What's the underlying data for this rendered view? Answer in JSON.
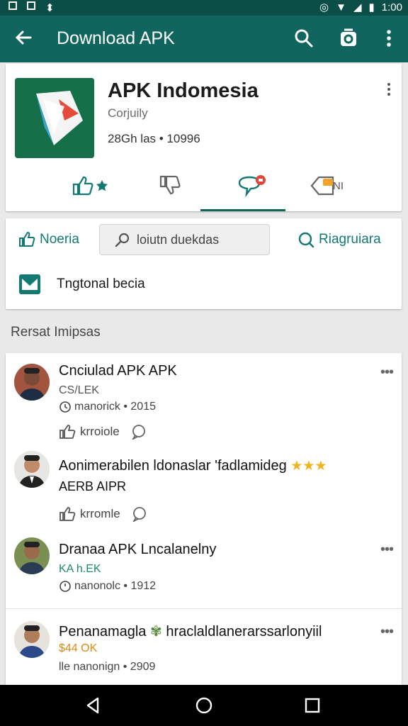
{
  "status_bar": {
    "time": "1:00"
  },
  "app_bar": {
    "title": "Download APK"
  },
  "app": {
    "name": "APK Indomesia",
    "developer": "Corjuily",
    "stats": "28Gh las • 10996",
    "tab_labels": [
      "",
      "",
      "",
      "NI"
    ]
  },
  "actions": {
    "left_link": "Noeria",
    "search_text": "loiutn duekdas",
    "right_link": "Riagruiara",
    "tag_label": "Tngtonal becia"
  },
  "section": {
    "title": "Rersat Imipsas"
  },
  "reviews": [
    {
      "title": "Cnciulad APK APK",
      "sub": "CS/LEK",
      "meta": "manorick • 2015",
      "action": "krroiole",
      "sub_color": "#555555"
    },
    {
      "title": "Aonimerabilen ldonaslar 'fadlamideg",
      "sub": "AERB AIPR",
      "meta": "",
      "action": "krromle",
      "sub_color": "#111111"
    },
    {
      "title": "Dranaa APK Lncalanelny",
      "sub": "KA h.EK",
      "meta": "nanonolc • 1912",
      "action": "",
      "sub_color": "#1e8a6e"
    },
    {
      "title": "Penanamagla",
      "title_tail": "hraclaldlanerarssarlonyiil",
      "sub": "$44 OK",
      "meta": "lle nanonign • 2909",
      "action": "",
      "sub_color": "#d98a12"
    }
  ],
  "colors": {
    "primary": "#10665e",
    "status_bar": "#0b4d47",
    "accent": "#137a73"
  },
  "icons": [
    "back-arrow-icon",
    "search-icon",
    "sync-icon",
    "more-vert-icon"
  ]
}
